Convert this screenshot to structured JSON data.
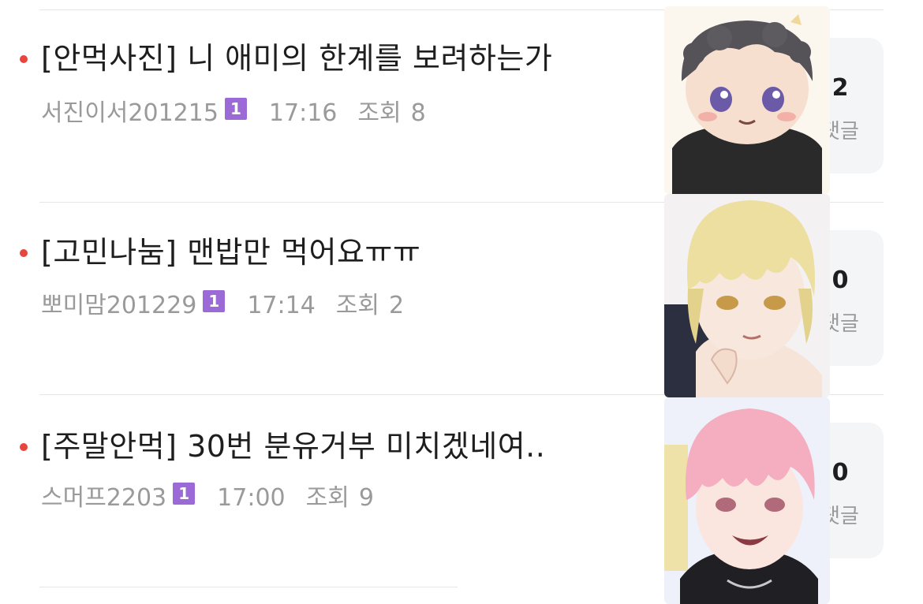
{
  "posts": [
    {
      "title": "[안먹사진] 니 애미의 한계를 보려하는가",
      "author": "서진이서201215",
      "badge": "1",
      "time": "17:16",
      "views_label": "조회",
      "views": "8",
      "comment_count": "2",
      "comment_label": "댓글"
    },
    {
      "title": "[고민나눔] 맨밥만 먹어요ㅠㅠ",
      "author": "뽀미맘201229",
      "badge": "1",
      "time": "17:14",
      "views_label": "조회",
      "views": "2",
      "comment_count": "0",
      "comment_label": "댓글"
    },
    {
      "title": "[주말안먹] 30번 분유거부 미치겠네여..",
      "author": "스머프2203",
      "badge": "1",
      "time": "17:00",
      "views_label": "조회",
      "views": "9",
      "comment_count": "0",
      "comment_label": "댓글"
    }
  ],
  "colors": {
    "bullet": "#e8453c",
    "badge": "#9c6ad6",
    "meta_text": "#9a9a9a",
    "comment_box_bg": "#f4f5f7"
  },
  "icons": {
    "bullet": "red-dot-icon",
    "badge": "level-badge-icon"
  }
}
